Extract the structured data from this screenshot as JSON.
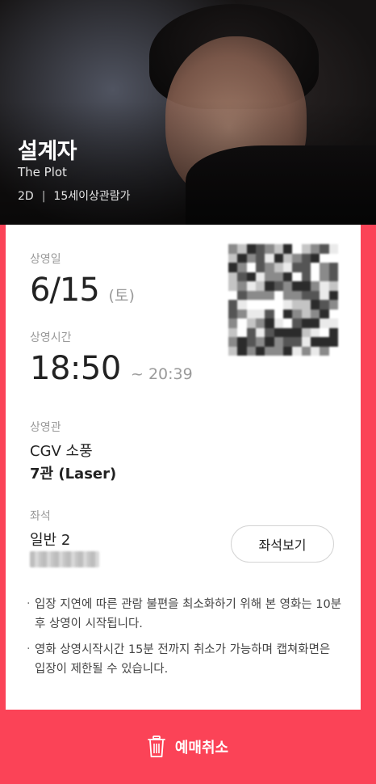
{
  "movie": {
    "title": "설계자",
    "subtitle": "The Plot",
    "format": "2D",
    "rating": "15세이상관람가"
  },
  "ticket": {
    "date_label": "상영일",
    "date": "6/15",
    "day_of_week": "(토)",
    "time_label": "상영시간",
    "start_time": "18:50",
    "end_time": "~ 20:39",
    "theater_label": "상영관",
    "theater_name": "CGV 소풍",
    "screen": "7관 (Laser)",
    "seat_label": "좌석",
    "seat_type": "일반 2",
    "seat_button_label": "좌석보기"
  },
  "notices": [
    "입장 지연에 따른 관람 불편을 최소화하기 위해 본 영화는 10분 후 상영이 시작됩니다.",
    "영화 상영시작시간 15분 전까지 취소가 가능하며 캡쳐화면은 입장이 제한될 수 있습니다."
  ],
  "actions": {
    "cancel_label": "예매취소"
  },
  "colors": {
    "accent": "#fb4357",
    "text_primary": "#222222",
    "text_secondary": "#9a9a9a"
  }
}
